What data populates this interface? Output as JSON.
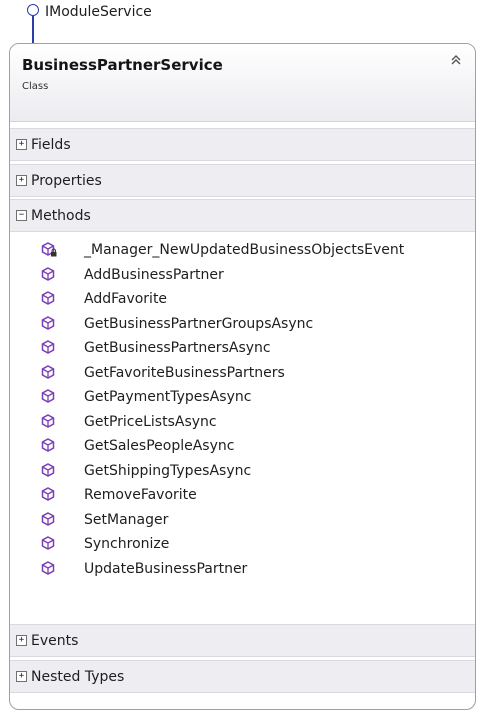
{
  "interface": {
    "label": "IModuleService"
  },
  "class": {
    "title": "BusinessPartnerService",
    "subtitle": "Class"
  },
  "sections": {
    "fields": {
      "label": "Fields",
      "toggle": "+"
    },
    "properties": {
      "label": "Properties",
      "toggle": "+"
    },
    "methods": {
      "label": "Methods",
      "toggle": "−"
    },
    "events": {
      "label": "Events",
      "toggle": "+"
    },
    "nested_types": {
      "label": "Nested Types",
      "toggle": "+"
    }
  },
  "methods": [
    {
      "name": "_Manager_NewUpdatedBusinessObjectsEvent",
      "access": "private"
    },
    {
      "name": "AddBusinessPartner",
      "access": "public"
    },
    {
      "name": "AddFavorite",
      "access": "public"
    },
    {
      "name": "GetBusinessPartnerGroupsAsync",
      "access": "public"
    },
    {
      "name": "GetBusinessPartnersAsync",
      "access": "public"
    },
    {
      "name": "GetFavoriteBusinessPartners",
      "access": "public"
    },
    {
      "name": "GetPaymentTypesAsync",
      "access": "public"
    },
    {
      "name": "GetPriceListsAsync",
      "access": "public"
    },
    {
      "name": "GetSalesPeopleAsync",
      "access": "public"
    },
    {
      "name": "GetShippingTypesAsync",
      "access": "public"
    },
    {
      "name": "RemoveFavorite",
      "access": "public"
    },
    {
      "name": "SetManager",
      "access": "public"
    },
    {
      "name": "Synchronize",
      "access": "public"
    },
    {
      "name": "UpdateBusinessPartner",
      "access": "public"
    }
  ],
  "colors": {
    "method_icon": "#7a3fb8",
    "interface_line": "#2b3ea8"
  },
  "icons": {
    "method": "method-cube-icon",
    "private_overlay": "lock-icon",
    "interface": "interface-lollipop-icon",
    "collapse": "double-chevron-up-icon"
  }
}
